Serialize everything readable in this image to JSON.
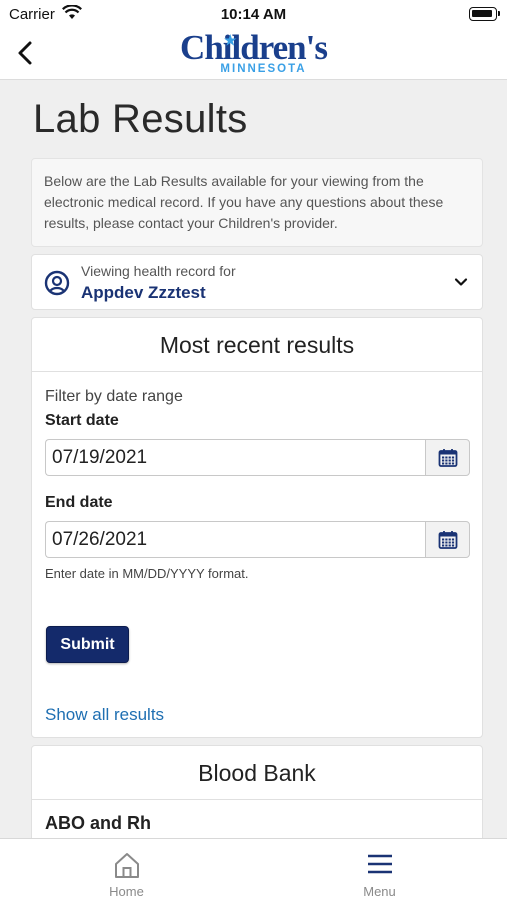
{
  "status_bar": {
    "carrier": "Carrier",
    "time": "10:14 AM"
  },
  "header": {
    "logo_name": "Children's",
    "logo_sub": "MINNESOTA",
    "brand_color": "#1a3f8c",
    "accent_color": "#3aa0e6"
  },
  "page": {
    "title": "Lab Results",
    "info": "Below are the Lab Results available for your viewing from the electronic medical record. If you have any questions about these results, please contact your Children's provider."
  },
  "record": {
    "label": "Viewing health record for",
    "name": "Appdev Zzztest",
    "icon": "user-circle-icon"
  },
  "results": {
    "title": "Most recent results",
    "filter_label": "Filter by date range",
    "start_label": "Start date",
    "start_value": "07/19/2021",
    "end_label": "End date",
    "end_value": "07/26/2021",
    "hint": "Enter date in MM/DD/YYYY format.",
    "submit_label": "Submit",
    "submit_color": "#142a6b",
    "show_all_label": "Show all results",
    "link_color": "#1f6fb2"
  },
  "blood_bank": {
    "title": "Blood Bank",
    "first_item": "ABO and Rh"
  },
  "tab_bar": {
    "tabs": [
      {
        "label": "Home",
        "icon": "home-icon"
      },
      {
        "label": "Menu",
        "icon": "menu-icon"
      }
    ]
  }
}
